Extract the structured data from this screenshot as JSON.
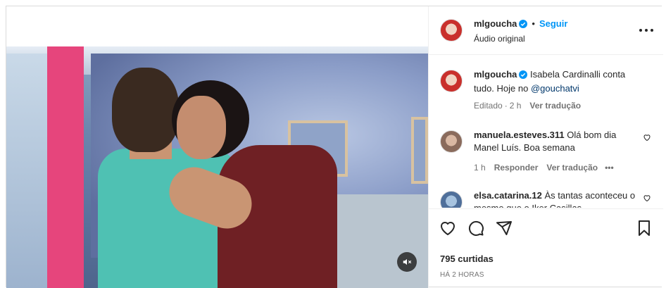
{
  "header": {
    "username": "mlgoucha",
    "separator": "•",
    "follow_label": "Seguir",
    "audio_label": "Áudio original"
  },
  "caption": {
    "username": "mlgoucha",
    "text": "Isabela Cardinalli conta tudo. Hoje no ",
    "mention": "@gouchatvi",
    "edited": "Editado",
    "time": "2 h",
    "translate": "Ver tradução"
  },
  "comments": [
    {
      "username": "manuela.esteves.311",
      "text": "Olá bom dia Manel Luís. Boa semana",
      "time": "1 h",
      "reply": "Responder",
      "translate": "Ver tradução",
      "more": "•••"
    },
    {
      "username": "elsa.catarina.12",
      "text": "Às tantas aconteceu o mesmo que o Iker Casillas"
    }
  ],
  "footer": {
    "likes": "795 curtidas",
    "posted": "HÁ 2 HORAS"
  },
  "colors": {
    "follow": "#0095f6",
    "verified": "#0095f6",
    "muted_text": "#737373"
  }
}
